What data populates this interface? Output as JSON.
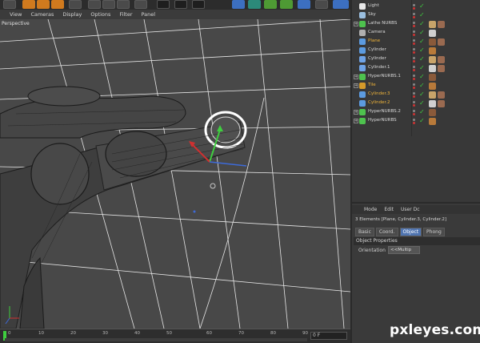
{
  "viewport": {
    "menu": [
      "View",
      "Cameras",
      "Display",
      "Options",
      "Filter",
      "Panel"
    ],
    "camera_label": "Perspective"
  },
  "objects": [
    {
      "name": "Light",
      "highlight": false,
      "expandable": false,
      "icon_color": "#e8e8e8"
    },
    {
      "name": "Sky",
      "highlight": false,
      "expandable": false,
      "icon_color": "#9bbfe0"
    },
    {
      "name": "Lathe NURBS",
      "highlight": false,
      "expandable": true,
      "icon_color": "#4ec24e"
    },
    {
      "name": "Camera",
      "highlight": false,
      "expandable": false,
      "icon_color": "#b0b0b0"
    },
    {
      "name": "Plane",
      "highlight": true,
      "expandable": false,
      "icon_color": "#5c9be0"
    },
    {
      "name": "Cylinder",
      "highlight": false,
      "expandable": false,
      "icon_color": "#5c9be0"
    },
    {
      "name": "Cylinder",
      "highlight": false,
      "expandable": false,
      "icon_color": "#6fa3e6"
    },
    {
      "name": "Cylinder.1",
      "highlight": false,
      "expandable": false,
      "icon_color": "#6fa3e6"
    },
    {
      "name": "HyperNURBS.1",
      "highlight": false,
      "expandable": true,
      "icon_color": "#4ec24e"
    },
    {
      "name": "Tile",
      "highlight": true,
      "expandable": true,
      "icon_color": "#d49a2a"
    },
    {
      "name": "Cylinder.3",
      "highlight": true,
      "expandable": false,
      "icon_color": "#5c9be0"
    },
    {
      "name": "Cylinder.2",
      "highlight": true,
      "expandable": false,
      "icon_color": "#5c9be0"
    },
    {
      "name": "HyperNURBS.2",
      "highlight": false,
      "expandable": true,
      "icon_color": "#4ec24e"
    },
    {
      "name": "HyperNURBS",
      "highlight": false,
      "expandable": true,
      "icon_color": "#4ec24e"
    }
  ],
  "attributes": {
    "menu": [
      "Mode",
      "Edit",
      "User Dc"
    ],
    "selection": "3 Elements [Plane, Cylinder.3, Cylinder.2]",
    "tabs": [
      "Basic",
      "Coord.",
      "Object",
      "Phong"
    ],
    "active_tab": "Object",
    "section_title": "Object Properties",
    "field_label": "Orientation",
    "field_value": "<<Multip"
  },
  "timeline": {
    "ticks": [
      "0",
      "10",
      "20",
      "30",
      "40",
      "50",
      "60",
      "70",
      "80",
      "90"
    ],
    "frame_value": "0 F"
  },
  "watermark": "pxleyes.com",
  "colors": {
    "viewport_bg": "#484848",
    "panel_bg": "#383838",
    "highlight_text": "#f0b43a",
    "active_tab": "#4f74b0"
  }
}
